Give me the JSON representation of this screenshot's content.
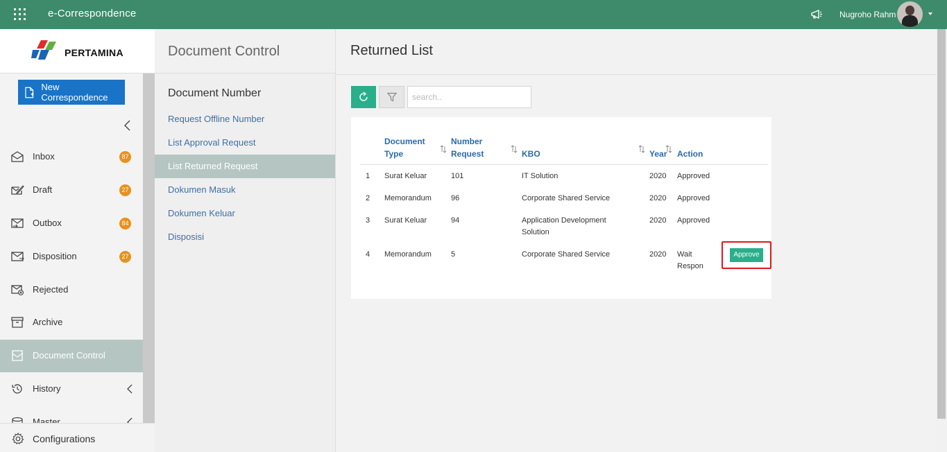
{
  "topbar": {
    "app_title": "e-Correspondence",
    "user_name": "Nugroho Rahm"
  },
  "sidebar": {
    "logo_text": "PERTAMINA",
    "new_button": "New Correspondence",
    "items": [
      {
        "label": "Inbox",
        "badge": "87",
        "icon": "inbox-icon"
      },
      {
        "label": "Draft",
        "badge": "27",
        "icon": "draft-icon"
      },
      {
        "label": "Outbox",
        "badge": "84",
        "icon": "outbox-icon"
      },
      {
        "label": "Disposition",
        "badge": "27",
        "icon": "disposition-icon"
      },
      {
        "label": "Rejected",
        "icon": "rejected-icon"
      },
      {
        "label": "Archive",
        "icon": "archive-icon"
      },
      {
        "label": "Document Control",
        "icon": "document-control-icon",
        "active": true
      },
      {
        "label": "History",
        "icon": "history-icon"
      },
      {
        "label": "Master",
        "icon": "master-icon"
      }
    ],
    "config_label": "Configurations"
  },
  "middle": {
    "title": "Document Control",
    "section_title": "Document Number",
    "items": [
      {
        "label": "Request Offline Number"
      },
      {
        "label": "List Approval Request"
      },
      {
        "label": "List Returned Request",
        "active": true
      },
      {
        "label": "Dokumen Masuk"
      },
      {
        "label": "Dokumen Keluar"
      },
      {
        "label": "Disposisi"
      }
    ]
  },
  "main": {
    "title": "Returned List",
    "search_placeholder": "search..",
    "table": {
      "headers": {
        "doc_type_1": "Document",
        "doc_type_2": "Type",
        "number_1": "Number",
        "number_2": "Request",
        "kbo": "KBO",
        "year": "Year",
        "action": "Action"
      },
      "rows": [
        {
          "no": "1",
          "type": "Surat Keluar",
          "number": "101",
          "kbo_1": "IT Solution",
          "kbo_2": "",
          "year": "2020",
          "action_1": "Approved",
          "action_2": ""
        },
        {
          "no": "2",
          "type": "Memorandum",
          "number": "96",
          "kbo_1": "Corporate Shared Service",
          "kbo_2": "",
          "year": "2020",
          "action_1": "Approved",
          "action_2": ""
        },
        {
          "no": "3",
          "type": "Surat Keluar",
          "number": "94",
          "kbo_1": "Application Development",
          "kbo_2": "Solution",
          "year": "2020",
          "action_1": "Approved",
          "action_2": ""
        },
        {
          "no": "4",
          "type": "Memorandum",
          "number": "5",
          "kbo_1": "Corporate Shared Service",
          "kbo_2": "",
          "year": "2020",
          "action_1": "Wait",
          "action_2": "Respon"
        }
      ],
      "approve_label": "Approve"
    }
  },
  "colors": {
    "topbar": "#3d8b6a",
    "primary_button": "#1973c6",
    "badge": "#e8911c",
    "accent_green": "#2aae8b",
    "highlight": "#e0161c"
  }
}
